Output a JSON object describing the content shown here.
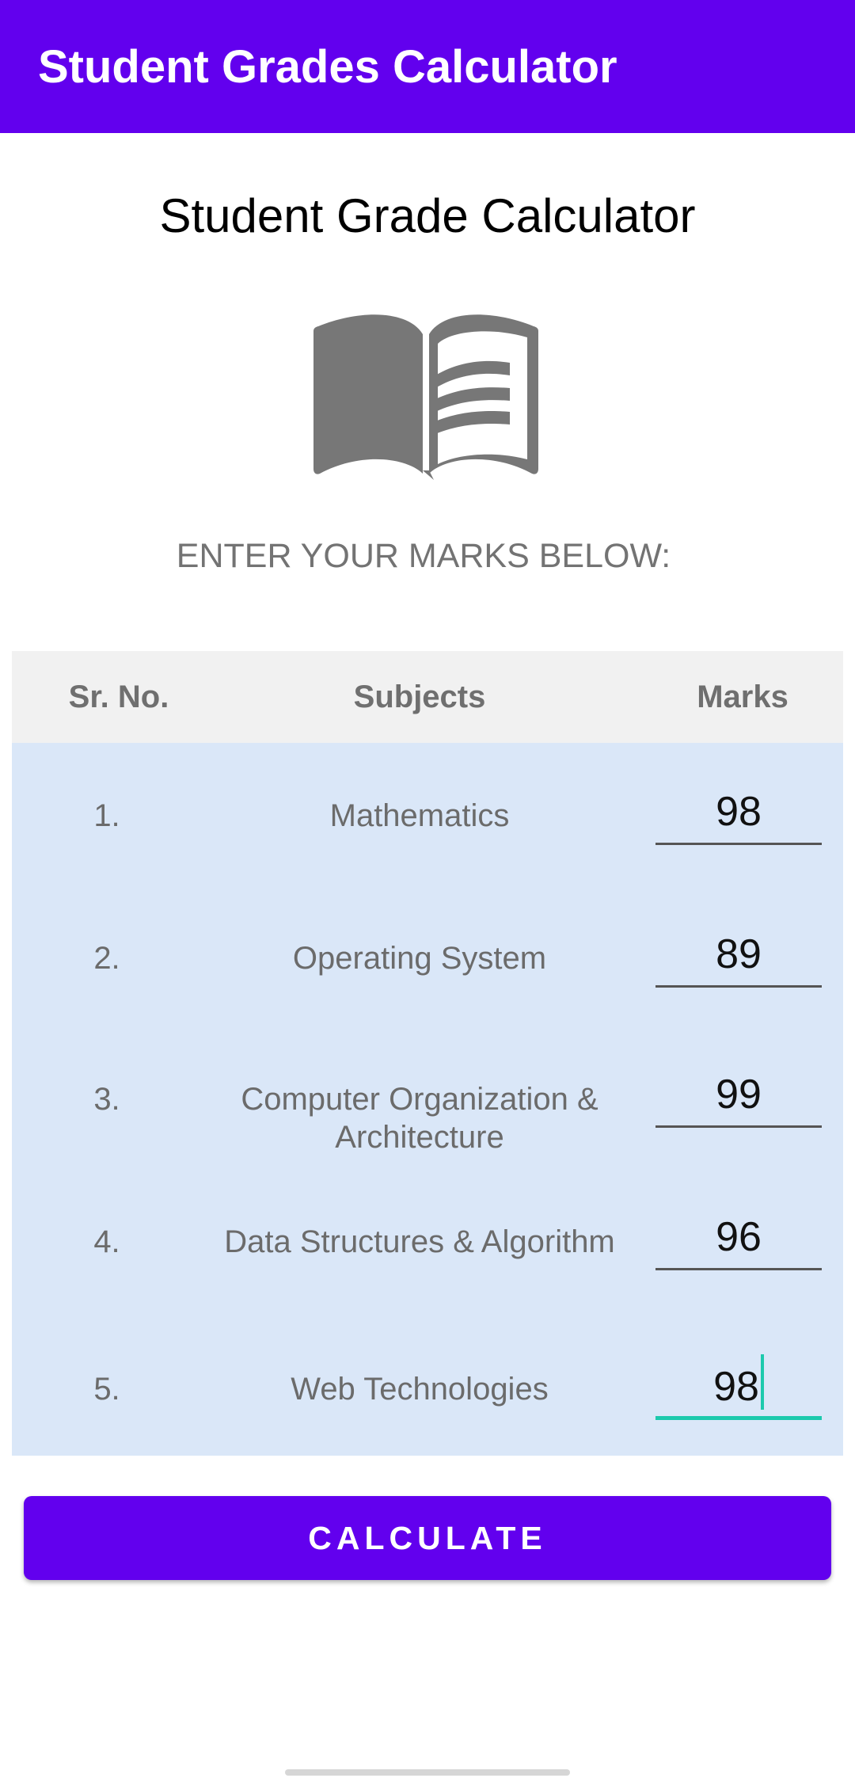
{
  "app_bar": {
    "title": "Student Grades Calculator"
  },
  "heading": "Student Grade Calculator",
  "instruction": "ENTER YOUR MARKS BELOW:",
  "icon": "open-book-icon",
  "table": {
    "headers": {
      "sr_no": "Sr. No.",
      "subjects": "Subjects",
      "marks": "Marks"
    },
    "rows": [
      {
        "no": "1.",
        "subject": "Mathematics",
        "marks": "98"
      },
      {
        "no": "2.",
        "subject": "Operating System",
        "marks": "89"
      },
      {
        "no": "3.",
        "subject": "Computer Organization & Architecture",
        "marks": "99"
      },
      {
        "no": "4.",
        "subject": "Data Structures & Algorithm",
        "marks": "96"
      },
      {
        "no": "5.",
        "subject": "Web Technologies",
        "marks": "98"
      }
    ]
  },
  "calculate_button": {
    "label": "CALCULATE"
  },
  "colors": {
    "primary": "#6200ee",
    "accent": "#1cc9ad",
    "table_body": "#dae7f8",
    "table_header": "#f1f1f1"
  }
}
